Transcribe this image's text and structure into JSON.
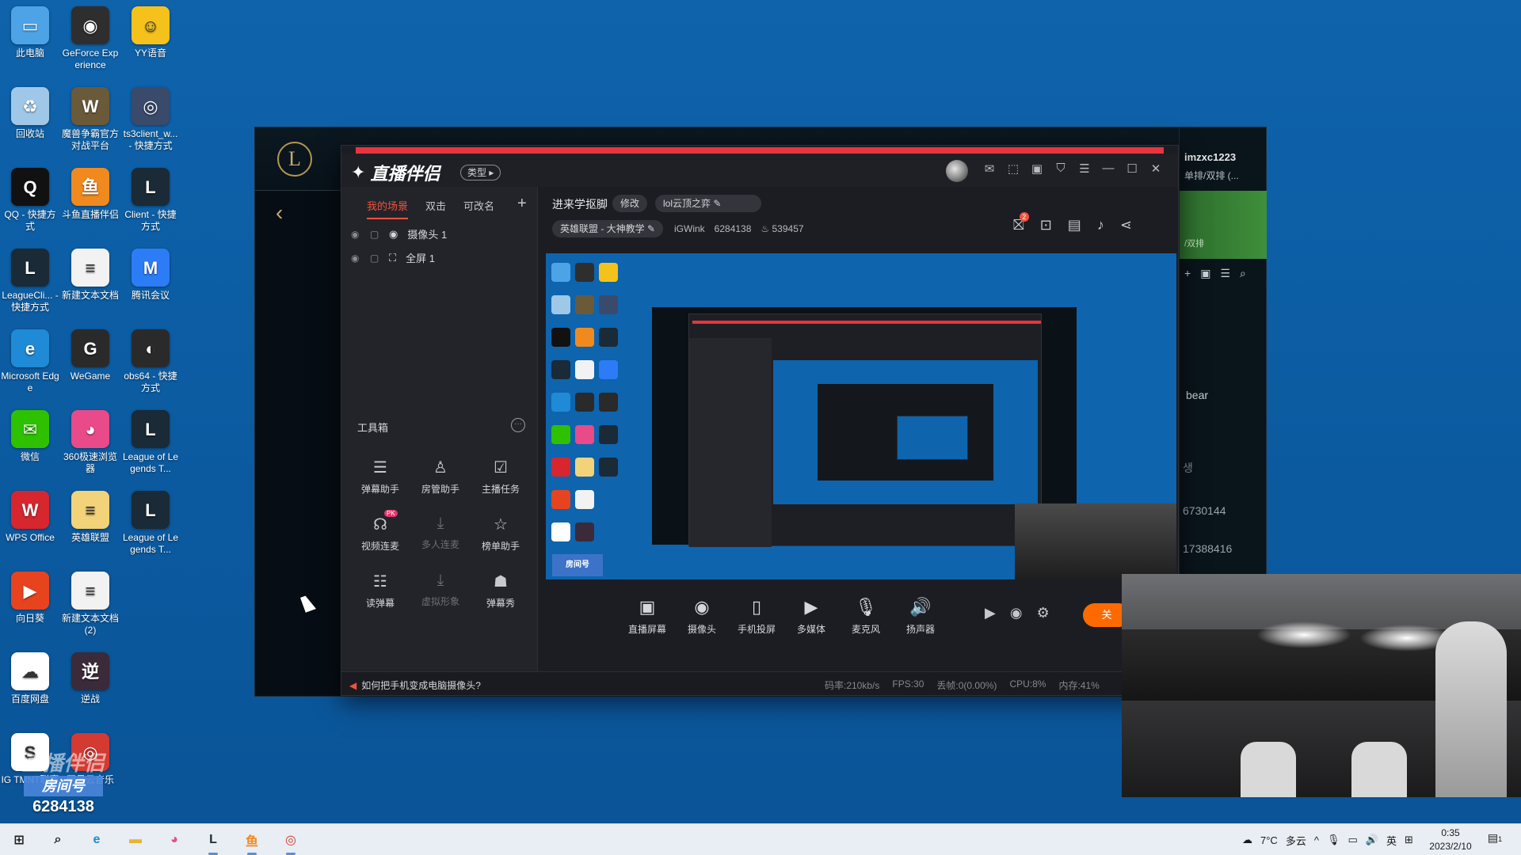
{
  "desktop": {
    "icons": [
      {
        "label": "此电脑",
        "icon": "computer-icon",
        "color": "#4ea3e6",
        "glyph": "▭"
      },
      {
        "label": "GeForce Experience",
        "icon": "nvidia-icon",
        "color": "#2e2e2e",
        "glyph": "◉"
      },
      {
        "label": "YY语音",
        "icon": "yy-icon",
        "color": "#f5c21b",
        "glyph": "☺"
      },
      {
        "label": "回收站",
        "icon": "recycle-bin-icon",
        "color": "#9fc8e8",
        "glyph": "♻"
      },
      {
        "label": "魔兽争霸官方对战平台",
        "icon": "warcraft-icon",
        "color": "#6b5a3a",
        "glyph": "W"
      },
      {
        "label": "ts3client_w... - 快捷方式",
        "icon": "teamspeak-icon",
        "color": "#3a4a6b",
        "glyph": "◎"
      },
      {
        "label": "QQ - 快捷方式",
        "icon": "qq-icon",
        "color": "#111111",
        "glyph": "Q"
      },
      {
        "label": "斗鱼直播伴侣",
        "icon": "douyu-icon",
        "color": "#f08a1e",
        "glyph": "鱼"
      },
      {
        "label": "Client - 快捷方式",
        "icon": "lol-client-icon",
        "color": "#1a2a36",
        "glyph": "L"
      },
      {
        "label": "LeagueCli... - 快捷方式",
        "icon": "league-client-icon",
        "color": "#1a2a36",
        "glyph": "L"
      },
      {
        "label": "新建文本文档",
        "icon": "text-file-icon",
        "color": "#f2f2f2",
        "glyph": "≡"
      },
      {
        "label": "腾讯会议",
        "icon": "tencent-meeting-icon",
        "color": "#2b7cf6",
        "glyph": "M"
      },
      {
        "label": "Microsoft Edge",
        "icon": "edge-icon",
        "color": "#1f8ad6",
        "glyph": "e"
      },
      {
        "label": "WeGame",
        "icon": "wegame-icon",
        "color": "#2a2a2a",
        "glyph": "G"
      },
      {
        "label": "obs64 - 快捷方式",
        "icon": "obs-icon",
        "color": "#2a2a2a",
        "glyph": "◐"
      },
      {
        "label": "微信",
        "icon": "wechat-icon",
        "color": "#2dc100",
        "glyph": "✉"
      },
      {
        "label": "360极速浏览器",
        "icon": "360-browser-icon",
        "color": "#e84a8a",
        "glyph": "◕"
      },
      {
        "label": "League of Legends T...",
        "icon": "lol-tw-icon",
        "color": "#1a2a36",
        "glyph": "L"
      },
      {
        "label": "WPS Office",
        "icon": "wps-icon",
        "color": "#d8262f",
        "glyph": "W"
      },
      {
        "label": "英雄联盟",
        "icon": "lol-cn-icon",
        "color": "#f2d37a",
        "glyph": "≡"
      },
      {
        "label": "League of Legends T...",
        "icon": "lol-tw2-icon",
        "color": "#1a2a36",
        "glyph": "L"
      },
      {
        "label": "向日葵",
        "icon": "sunflower-icon",
        "color": "#e8431f",
        "glyph": "▶"
      },
      {
        "label": "新建文本文档 (2)",
        "icon": "text-file2-icon",
        "color": "#f2f2f2",
        "glyph": "≡"
      },
      {
        "label": "百度网盘",
        "icon": "baidu-pan-icon",
        "color": "#ffffff",
        "glyph": "☁"
      },
      {
        "label": "逆战",
        "icon": "nizhan-icon",
        "color": "#3a2a3a",
        "glyph": "逆"
      },
      {
        "label": "IG TMNT联赛",
        "icon": "excel-icon",
        "color": "#ffffff",
        "glyph": "S"
      },
      {
        "label": "网易云音乐",
        "icon": "netease-music-icon",
        "color": "#d33a31",
        "glyph": "◎"
      }
    ]
  },
  "lol_client": {
    "logo": "L",
    "user_name": "imzxc1223",
    "status": "单排/双排 (...",
    "queue_text": "/双排",
    "bear_label": "bear",
    "num1": "6730144",
    "num2": "17388416",
    "side_char": "생",
    "actions": [
      "?",
      "—",
      "⚙",
      "✕"
    ]
  },
  "streamer": {
    "app_name": "直播伴侣",
    "type_label": "类型",
    "window_controls": [
      "✉",
      "⬚",
      "▣",
      "⛉",
      "☰",
      "—",
      "☐",
      "✕"
    ],
    "scene_tabs": [
      "我的场景",
      "双击",
      "可改名"
    ],
    "add_label": "+",
    "sources": [
      {
        "label": "摄像头 1",
        "icon": "camera-icon",
        "glyph": "◉"
      },
      {
        "label": "全屏 1",
        "icon": "fullscreen-icon",
        "glyph": "⛶"
      }
    ],
    "toolbox_title": "工具箱",
    "toolbox_more": "···",
    "tools": [
      {
        "label": "弹幕助手",
        "glyph": "☰",
        "dim": false
      },
      {
        "label": "房管助手",
        "glyph": "♙",
        "dim": false
      },
      {
        "label": "主播任务",
        "glyph": "☑",
        "dim": false
      },
      {
        "label": "视频连麦",
        "glyph": "☊",
        "dim": false,
        "badge": "PK"
      },
      {
        "label": "多人连麦",
        "glyph": "⤓",
        "dim": true
      },
      {
        "label": "榜单助手",
        "glyph": "☆",
        "dim": false
      },
      {
        "label": "读弹幕",
        "glyph": "☷",
        "dim": false
      },
      {
        "label": "虚拟形象",
        "glyph": "⤓",
        "dim": true
      },
      {
        "label": "弹幕秀",
        "glyph": "☗",
        "dim": false
      }
    ],
    "room_title": "进来学抠脚",
    "edit_label": "修改",
    "room_game": "lol云顶之弈",
    "category": "英雄联盟 - 大神教学",
    "room_user": "iGWink",
    "room_id": "6284138",
    "heat": "539457",
    "bottom_buttons": [
      {
        "label": "直播屏幕",
        "glyph": "▣",
        "icon": "screen-share-icon",
        "red": false
      },
      {
        "label": "摄像头",
        "glyph": "◉",
        "icon": "webcam-icon",
        "red": false
      },
      {
        "label": "手机投屏",
        "glyph": "▯",
        "icon": "phone-cast-icon",
        "red": false
      },
      {
        "label": "多媒体",
        "glyph": "▶",
        "icon": "media-icon",
        "red": false
      },
      {
        "label": "麦克风",
        "glyph": "🎙",
        "icon": "mic-icon",
        "red": false
      },
      {
        "label": "扬声器",
        "glyph": "🔊",
        "icon": "speaker-icon",
        "red": true
      }
    ],
    "start_label": "关",
    "tip": "如何把手机变成电脑摄像头?",
    "metrics": [
      "码率:210kb/s",
      "FPS:30",
      "丢帧:0(0.00%)",
      "CPU:8%",
      "内存:41%"
    ],
    "watermark_label": "房间号",
    "watermark_num": "6284138"
  },
  "taskbar": {
    "weather_temp": "7°C",
    "weather_desc": "多云",
    "ime": "英",
    "time": "0:35",
    "date": "2023/2/10",
    "notify_count": "1",
    "apps": [
      {
        "icon": "windows-start-icon",
        "glyph": "⊞",
        "color": "#1b1b1b"
      },
      {
        "icon": "search-icon",
        "glyph": "⌕",
        "color": "#1b1b1b"
      },
      {
        "icon": "edge-icon",
        "glyph": "e",
        "color": "#1f8ad6"
      },
      {
        "icon": "file-explorer-icon",
        "glyph": "▬",
        "color": "#e8b531"
      },
      {
        "icon": "360-browser-icon",
        "glyph": "◕",
        "color": "#e84a8a"
      },
      {
        "icon": "league-icon",
        "glyph": "L",
        "color": "#1a2a36"
      },
      {
        "icon": "douyu-icon",
        "glyph": "鱼",
        "color": "#f08a1e"
      },
      {
        "icon": "netease-music-icon",
        "glyph": "◎",
        "color": "#d33a31"
      }
    ]
  }
}
